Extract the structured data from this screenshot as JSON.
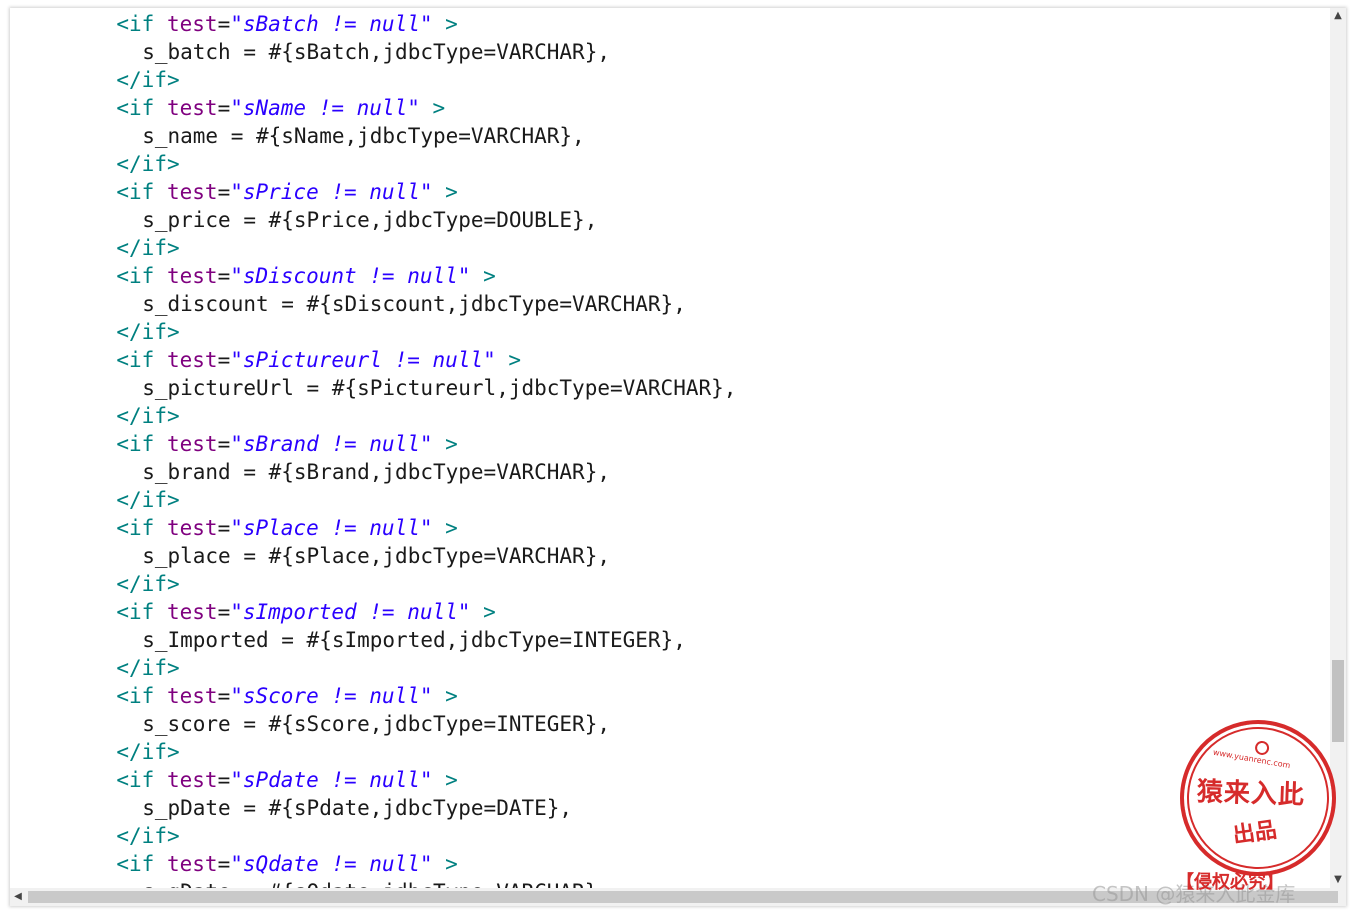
{
  "code_lines": [
    {
      "type": "if_open",
      "indent": 6,
      "parts": {
        "open": "<if",
        "attr": "test",
        "eq": "=",
        "value": "\"sBatch != null\"",
        "close": ">"
      }
    },
    {
      "type": "plain",
      "indent": 8,
      "text": "s_batch = #{sBatch,jdbcType=VARCHAR},"
    },
    {
      "type": "if_close",
      "indent": 6,
      "text": "</if>"
    },
    {
      "type": "if_open",
      "indent": 6,
      "parts": {
        "open": "<if",
        "attr": "test",
        "eq": "=",
        "value": "\"sName != null\"",
        "close": ">"
      }
    },
    {
      "type": "plain",
      "indent": 8,
      "text": "s_name = #{sName,jdbcType=VARCHAR},"
    },
    {
      "type": "if_close",
      "indent": 6,
      "text": "</if>"
    },
    {
      "type": "if_open",
      "indent": 6,
      "parts": {
        "open": "<if",
        "attr": "test",
        "eq": "=",
        "value": "\"sPrice != null\"",
        "close": ">"
      }
    },
    {
      "type": "plain",
      "indent": 8,
      "text": "s_price = #{sPrice,jdbcType=DOUBLE},"
    },
    {
      "type": "if_close",
      "indent": 6,
      "text": "</if>"
    },
    {
      "type": "if_open",
      "indent": 6,
      "parts": {
        "open": "<if",
        "attr": "test",
        "eq": "=",
        "value": "\"sDiscount != null\"",
        "close": ">"
      }
    },
    {
      "type": "plain",
      "indent": 8,
      "text": "s_discount = #{sDiscount,jdbcType=VARCHAR},"
    },
    {
      "type": "if_close",
      "indent": 6,
      "text": "</if>"
    },
    {
      "type": "if_open",
      "indent": 6,
      "parts": {
        "open": "<if",
        "attr": "test",
        "eq": "=",
        "value": "\"sPictureurl != null\"",
        "close": ">"
      }
    },
    {
      "type": "plain",
      "indent": 8,
      "text": "s_pictureUrl = #{sPictureurl,jdbcType=VARCHAR},"
    },
    {
      "type": "if_close",
      "indent": 6,
      "text": "</if>"
    },
    {
      "type": "if_open",
      "indent": 6,
      "parts": {
        "open": "<if",
        "attr": "test",
        "eq": "=",
        "value": "\"sBrand != null\"",
        "close": ">"
      }
    },
    {
      "type": "plain",
      "indent": 8,
      "text": "s_brand = #{sBrand,jdbcType=VARCHAR},"
    },
    {
      "type": "if_close",
      "indent": 6,
      "text": "</if>"
    },
    {
      "type": "if_open",
      "indent": 6,
      "parts": {
        "open": "<if",
        "attr": "test",
        "eq": "=",
        "value": "\"sPlace != null\"",
        "close": ">"
      }
    },
    {
      "type": "plain",
      "indent": 8,
      "text": "s_place = #{sPlace,jdbcType=VARCHAR},"
    },
    {
      "type": "if_close",
      "indent": 6,
      "text": "</if>"
    },
    {
      "type": "if_open",
      "indent": 6,
      "parts": {
        "open": "<if",
        "attr": "test",
        "eq": "=",
        "value": "\"sImported != null\"",
        "close": ">"
      }
    },
    {
      "type": "plain",
      "indent": 8,
      "text": "s_Imported = #{sImported,jdbcType=INTEGER},"
    },
    {
      "type": "if_close",
      "indent": 6,
      "text": "</if>"
    },
    {
      "type": "if_open",
      "indent": 6,
      "parts": {
        "open": "<if",
        "attr": "test",
        "eq": "=",
        "value": "\"sScore != null\"",
        "close": ">"
      }
    },
    {
      "type": "plain",
      "indent": 8,
      "text": "s_score = #{sScore,jdbcType=INTEGER},"
    },
    {
      "type": "if_close",
      "indent": 6,
      "text": "</if>"
    },
    {
      "type": "if_open",
      "indent": 6,
      "parts": {
        "open": "<if",
        "attr": "test",
        "eq": "=",
        "value": "\"sPdate != null\"",
        "close": ">"
      }
    },
    {
      "type": "plain",
      "indent": 8,
      "text": "s_pDate = #{sPdate,jdbcType=DATE},"
    },
    {
      "type": "if_close",
      "indent": 6,
      "text": "</if>"
    },
    {
      "type": "if_open",
      "indent": 6,
      "parts": {
        "open": "<if",
        "attr": "test",
        "eq": "=",
        "value": "\"sQdate != null\"",
        "close": ">"
      }
    },
    {
      "type": "plain",
      "indent": 8,
      "text": "s_qDate = #{sQdate,jdbcType=VARCHAR},"
    }
  ],
  "scrollbars": {
    "vertical": {
      "position": 0.83,
      "up_icon": "arrow-up-icon",
      "down_icon": "arrow-down-icon"
    },
    "horizontal": {
      "left_icon": "arrow-left-icon"
    }
  },
  "watermark": {
    "stamp_url": "www.yuanrenc.com",
    "stamp_main": "猿来入此",
    "stamp_sub": "出品",
    "stamp_caption": "【侵权必究】",
    "csdn": "CSDN @猿来入此金库"
  },
  "colors": {
    "tag": "#008080",
    "attr": "#7f007f",
    "value": "#2a00ff",
    "text": "#1a1a1a",
    "stamp": "#d62b2b"
  }
}
